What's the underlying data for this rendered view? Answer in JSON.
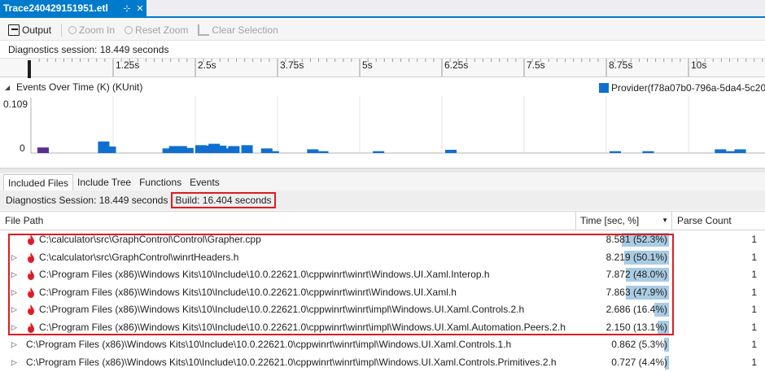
{
  "tab": {
    "title": "Trace240429151951.etl",
    "pin": "⊹",
    "close": "✕"
  },
  "toolbar": {
    "output": "Output",
    "zoom_in": "Zoom In",
    "reset_zoom": "Reset Zoom",
    "clear_selection": "Clear Selection"
  },
  "session_label": "Diagnostics session: 18.449 seconds",
  "ruler": {
    "ticks": [
      "1.25s",
      "2.5s",
      "3.75s",
      "5s",
      "6.25s",
      "7.5s",
      "8.75s",
      "10s"
    ]
  },
  "events": {
    "title": "Events Over Time (K) (KUnit)",
    "legend": "Provider(f78a07b0-796a-5da4-5c20-",
    "y_max_label": "0.109",
    "y_min_label": "0"
  },
  "chart_data": {
    "type": "bar",
    "title": "Events Over Time (K) (KUnit)",
    "ylabel": "",
    "ylim": [
      0,
      0.109
    ],
    "series": [
      {
        "name": "Provider(f78a07b0-796a-5da4-5c20-",
        "color": "#0e6fd1",
        "x": [
          1.02,
          1.12,
          2.0,
          2.1,
          2.2,
          2.3,
          2.5,
          2.6,
          2.7,
          2.8,
          2.9,
          3.0,
          3.2,
          3.5,
          3.6,
          4.2,
          4.35,
          5.2,
          6.3,
          8.8,
          9.3,
          10.4,
          10.55,
          10.7
        ],
        "values": [
          0.025,
          0.014,
          0.01,
          0.015,
          0.015,
          0.011,
          0.017,
          0.016,
          0.02,
          0.016,
          0.01,
          0.015,
          0.017,
          0.01,
          0.004,
          0.008,
          0.004,
          0.004,
          0.007,
          0.004,
          0.004,
          0.008,
          0.004,
          0.008
        ]
      },
      {
        "name": "",
        "color": "#5c2d91",
        "x": [
          0.1
        ],
        "values": [
          0.012
        ]
      }
    ]
  },
  "subtabs": [
    "Included Files",
    "Include Tree",
    "Functions",
    "Events"
  ],
  "summary": {
    "session": "Diagnostics Session: 18.449 seconds",
    "build": "Build: 16.404 seconds"
  },
  "columns": {
    "path": "File Path",
    "time": "Time [sec, %]",
    "parse": "Parse Count"
  },
  "rows": [
    {
      "path": "C:\\calculator\\src\\GraphControl\\Control\\Grapher.cpp",
      "time": "8.581 (52.3%)",
      "pct": 52.3,
      "count": "1",
      "expandable": false,
      "hot": true,
      "indent": 1
    },
    {
      "path": "C:\\calculator\\src\\GraphControl\\winrtHeaders.h",
      "time": "8.219 (50.1%)",
      "pct": 50.1,
      "count": "1",
      "expandable": true,
      "hot": true,
      "indent": 1
    },
    {
      "path": "C:\\Program Files (x86)\\Windows Kits\\10\\Include\\10.0.22621.0\\cppwinrt\\winrt\\Windows.UI.Xaml.Interop.h",
      "time": "7.872 (48.0%)",
      "pct": 48.0,
      "count": "1",
      "expandable": true,
      "hot": true,
      "indent": 1
    },
    {
      "path": "C:\\Program Files (x86)\\Windows Kits\\10\\Include\\10.0.22621.0\\cppwinrt\\winrt\\Windows.UI.Xaml.h",
      "time": "7.863 (47.9%)",
      "pct": 47.9,
      "count": "1",
      "expandable": true,
      "hot": true,
      "indent": 1
    },
    {
      "path": "C:\\Program Files (x86)\\Windows Kits\\10\\Include\\10.0.22621.0\\cppwinrt\\winrt\\impl\\Windows.UI.Xaml.Controls.2.h",
      "time": "2.686 (16.4%)",
      "pct": 16.4,
      "count": "1",
      "expandable": true,
      "hot": true,
      "indent": 1
    },
    {
      "path": "C:\\Program Files (x86)\\Windows Kits\\10\\Include\\10.0.22621.0\\cppwinrt\\winrt\\impl\\Windows.UI.Xaml.Automation.Peers.2.h",
      "time": "2.150 (13.1%)",
      "pct": 13.1,
      "count": "1",
      "expandable": true,
      "hot": true,
      "indent": 1
    },
    {
      "path": "C:\\Program Files (x86)\\Windows Kits\\10\\Include\\10.0.22621.0\\cppwinrt\\winrt\\impl\\Windows.UI.Xaml.Controls.1.h",
      "time": "0.862 (5.3%)",
      "pct": 5.3,
      "count": "1",
      "expandable": true,
      "hot": false,
      "indent": 1
    },
    {
      "path": "C:\\Program Files (x86)\\Windows Kits\\10\\Include\\10.0.22621.0\\cppwinrt\\winrt\\impl\\Windows.UI.Xaml.Controls.Primitives.2.h",
      "time": "0.727 (4.4%)",
      "pct": 4.4,
      "count": "1",
      "expandable": true,
      "hot": false,
      "indent": 1
    }
  ],
  "colors": {
    "accent": "#007acc",
    "bar": "#0e6fd1",
    "time_bar": "#a9cce3",
    "highlight": "#e01b24",
    "flame": "#e01b24"
  }
}
